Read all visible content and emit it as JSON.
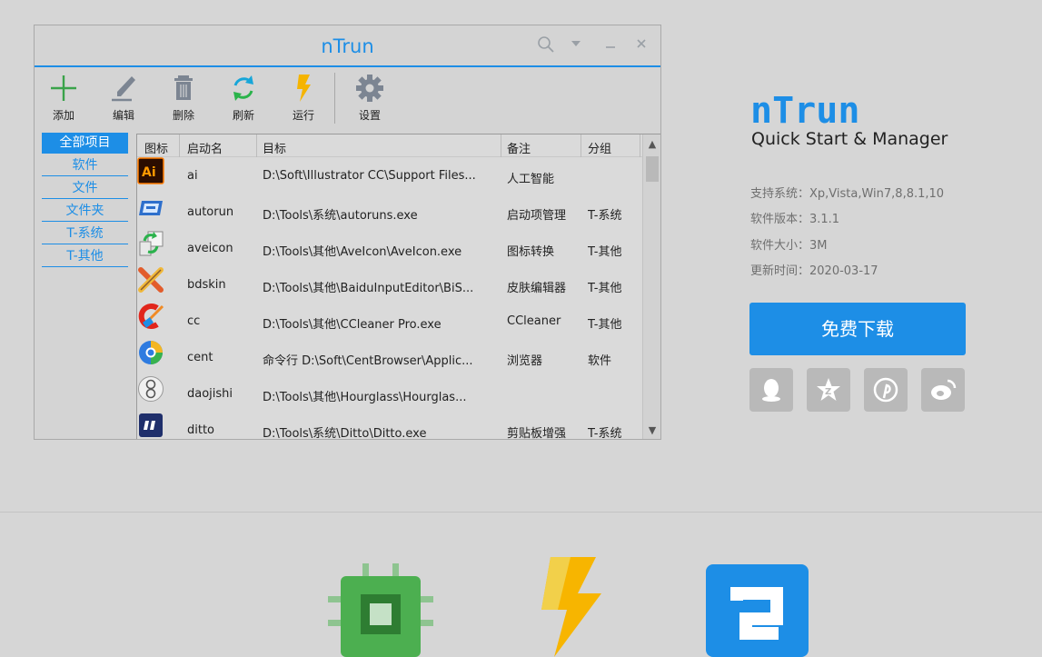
{
  "window": {
    "title": "nTrun",
    "controls": {
      "search": "⚲",
      "menu": "▾",
      "minimize": "–",
      "close": "✕"
    }
  },
  "toolbar": {
    "add": "添加",
    "edit": "编辑",
    "delete": "删除",
    "refresh": "刷新",
    "run": "运行",
    "settings": "设置"
  },
  "sidebar": {
    "items": [
      {
        "label": "全部项目",
        "active": true
      },
      {
        "label": "软件"
      },
      {
        "label": "文件"
      },
      {
        "label": "文件夹"
      },
      {
        "label": "T-系统"
      },
      {
        "label": "T-其他"
      }
    ]
  },
  "table": {
    "headers": {
      "icon": "图标",
      "name": "启动名",
      "target": "目标",
      "note": "备注",
      "group": "分组"
    },
    "rows": [
      {
        "icon": "illustrator-icon",
        "name": "ai",
        "target": "D:\\Soft\\Illustrator CC\\Support Files...",
        "note": "人工智能",
        "group": ""
      },
      {
        "icon": "autoruns-icon",
        "name": "autorun",
        "target": "D:\\Tools\\系统\\autoruns.exe",
        "note": "启动项管理",
        "group": "T-系统"
      },
      {
        "icon": "aveicon-icon",
        "name": "aveicon",
        "target": "D:\\Tools\\其他\\AveIcon\\AveIcon.exe",
        "note": "图标转换",
        "group": "T-其他"
      },
      {
        "icon": "bdskin-icon",
        "name": "bdskin",
        "target": "D:\\Tools\\其他\\BaiduInputEditor\\BiS...",
        "note": "皮肤编辑器",
        "group": "T-其他"
      },
      {
        "icon": "ccleaner-icon",
        "name": "cc",
        "target": "D:\\Tools\\其他\\CCleaner Pro.exe",
        "note": "CCleaner",
        "group": "T-其他"
      },
      {
        "icon": "centbrowser-icon",
        "name": "cent",
        "target": "命令行 D:\\Soft\\CentBrowser\\Applic...",
        "note": "浏览器",
        "group": "软件"
      },
      {
        "icon": "hourglass-icon",
        "name": "daojishi",
        "target": "D:\\Tools\\其他\\Hourglass\\Hourglas...",
        "note": "",
        "group": ""
      },
      {
        "icon": "ditto-icon",
        "name": "ditto",
        "target": "D:\\Tools\\系统\\Ditto\\Ditto.exe",
        "note": "剪贴板增强",
        "group": "T-系统"
      }
    ]
  },
  "product": {
    "logo": "nTrun",
    "subtitle": "Quick Start & Manager",
    "system": "支持系统：Xp,Vista,Win7,8,8.1,10",
    "version": "软件版本：3.1.1",
    "size": "软件大小：3M",
    "updated": "更新时间：2020-03-17",
    "download": "免费下载"
  },
  "colors": {
    "accent": "#1d8ee6",
    "background": "#d6d6d6",
    "share": "#b9b9b9",
    "chip": "#4caf50",
    "bolt": "#f7b500"
  }
}
